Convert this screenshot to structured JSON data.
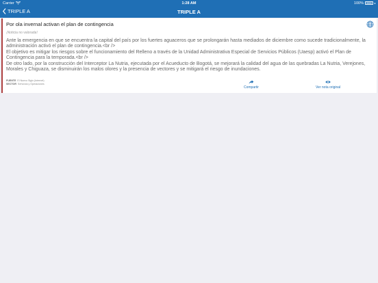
{
  "status_bar": {
    "carrier": "Carrier",
    "time": "1:28 AM",
    "battery": "100%"
  },
  "nav": {
    "back_label": "TRIPLE A",
    "title": "TRIPLE A"
  },
  "article": {
    "title": "Por ola invernal activan el plan de contingencia",
    "rating": "¡Noticia no valorada!",
    "body": [
      "Ante la emergencia en que se encuentra la capital del país por los fuertes aguaceros que se prolongarán hasta mediados de diciembre como sucede tradicionalmente, la administración activó el plan de contingencia.<br />",
      "El objetivo es mitigar los riesgos sobre el funcionamiento del Relleno a través de la Unidad Administrativa Especial de Servicios Públicos (Uaesp) activó el Plan de Contingencia para la temporada.<br />",
      "De otro lado, por la construcción del Interceptor La Nutria, ejecutada por el Acueducto de Bogotá, se mejorará la calidad del agua de las quebradas La Nutria, Verejones, Morales y Chiguaza, se disminuirán los malos olores y la presencia de vectores y se mitigará el riesgo de inundaciones."
    ],
    "meta": {
      "source_label": "FUENTE",
      "source_value": "El Nuevo Siglo (Internet)",
      "sector_label": "SECTOR",
      "sector_value": "Servicios y Operaciones"
    },
    "actions": {
      "share_label": "Compartir",
      "view_label": "Ver nota original"
    }
  },
  "colors": {
    "accent": "#1f6fb5",
    "card_border": "#ad3f3f",
    "background": "#efeff4"
  },
  "icons": [
    "wifi-icon",
    "battery-icon",
    "back-chevron-icon",
    "globe-icon",
    "share-icon",
    "eye-icon"
  ]
}
